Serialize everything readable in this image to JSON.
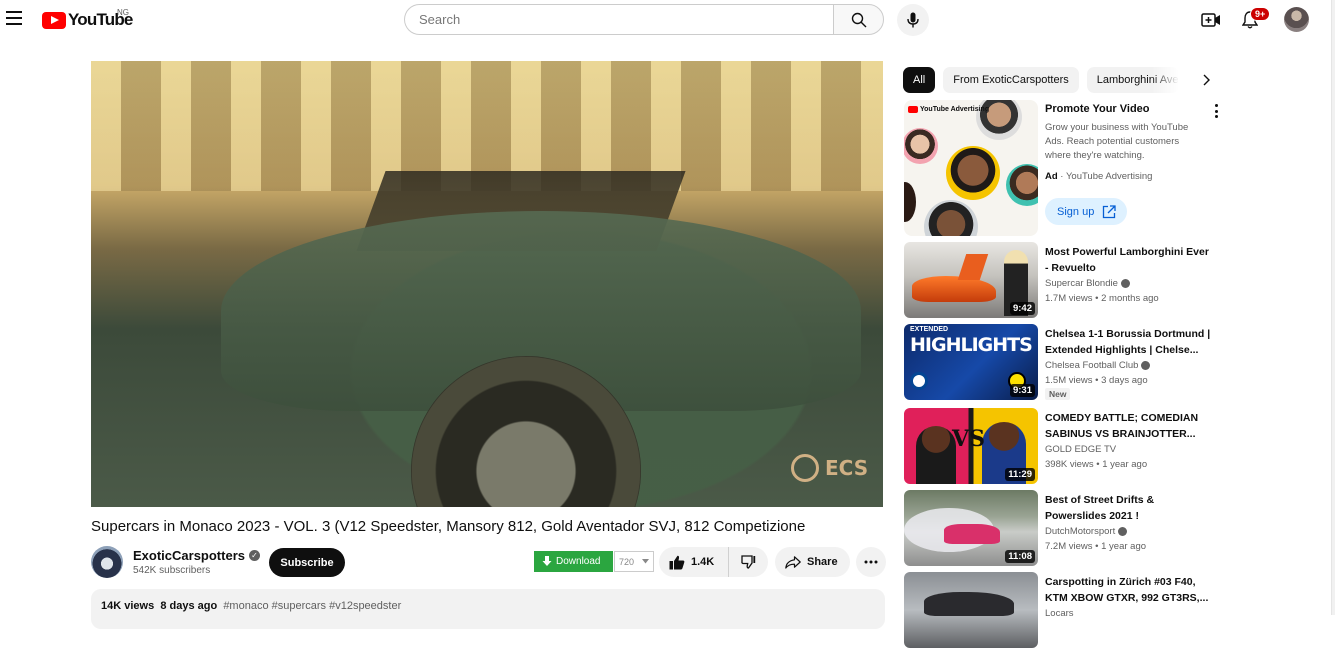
{
  "header": {
    "logo_text": "YouTube",
    "country_code": "NG",
    "search_placeholder": "Search",
    "notification_badge": "9+"
  },
  "video": {
    "watermark": "ECS",
    "title": "Supercars in Monaco 2023 - VOL. 3 (V12 Speedster, Mansory 812, Gold Aventador SVJ, 812 Competizione",
    "channel_name": "ExoticCarspotters",
    "subscribers": "542K subscribers",
    "subscribe_label": "Subscribe",
    "download_label": "Download",
    "quality_value": "720",
    "likes": "1.4K",
    "share_label": "Share",
    "views": "14K views",
    "age": "8 days ago",
    "hashtags": "#monaco #supercars #v12speedster"
  },
  "sidebar": {
    "chips": [
      "All",
      "From ExoticCarspotters",
      "Lamborghini Aven"
    ],
    "ad": {
      "label": "YouTube Advertising",
      "title": "Promote Your Video",
      "description": "Grow your business with YouTube Ads. Reach potential customers where they're watching.",
      "ad_tag": "Ad",
      "advertiser": "YouTube Advertising",
      "cta": "Sign up"
    },
    "recommendations": [
      {
        "title": "Most Powerful Lamborghini Ever - Revuelto",
        "channel": "Supercar Blondie",
        "views": "1.7M views",
        "age": "2 months ago",
        "duration": "9:42",
        "badge": ""
      },
      {
        "title": "Chelsea 1-1 Borussia Dortmund | Extended Highlights | Chelse...",
        "channel": "Chelsea Football Club",
        "views": "1.5M views",
        "age": "3 days ago",
        "duration": "9:31",
        "badge": "New"
      },
      {
        "title": "COMEDY BATTLE; COMEDIAN SABINUS VS BRAINJOTTER...",
        "channel": "GOLD EDGE TV",
        "views": "398K views",
        "age": "1 year ago",
        "duration": "11:29",
        "badge": ""
      },
      {
        "title": "Best of Street Drifts & Powerslides 2021 !",
        "channel": "DutchMotorsport",
        "views": "7.2M views",
        "age": "1 year ago",
        "duration": "11:08",
        "badge": ""
      },
      {
        "title": "Carspotting in Zürich #03 F40, KTM XBOW GTXR, 992 GT3RS,...",
        "channel": "Locars",
        "views": "",
        "age": "",
        "duration": "",
        "badge": ""
      }
    ],
    "thumb_texts": {
      "highlights_top": "EXTENDED",
      "highlights_main": "HIGHLIGHTS",
      "vs": "VS"
    }
  }
}
